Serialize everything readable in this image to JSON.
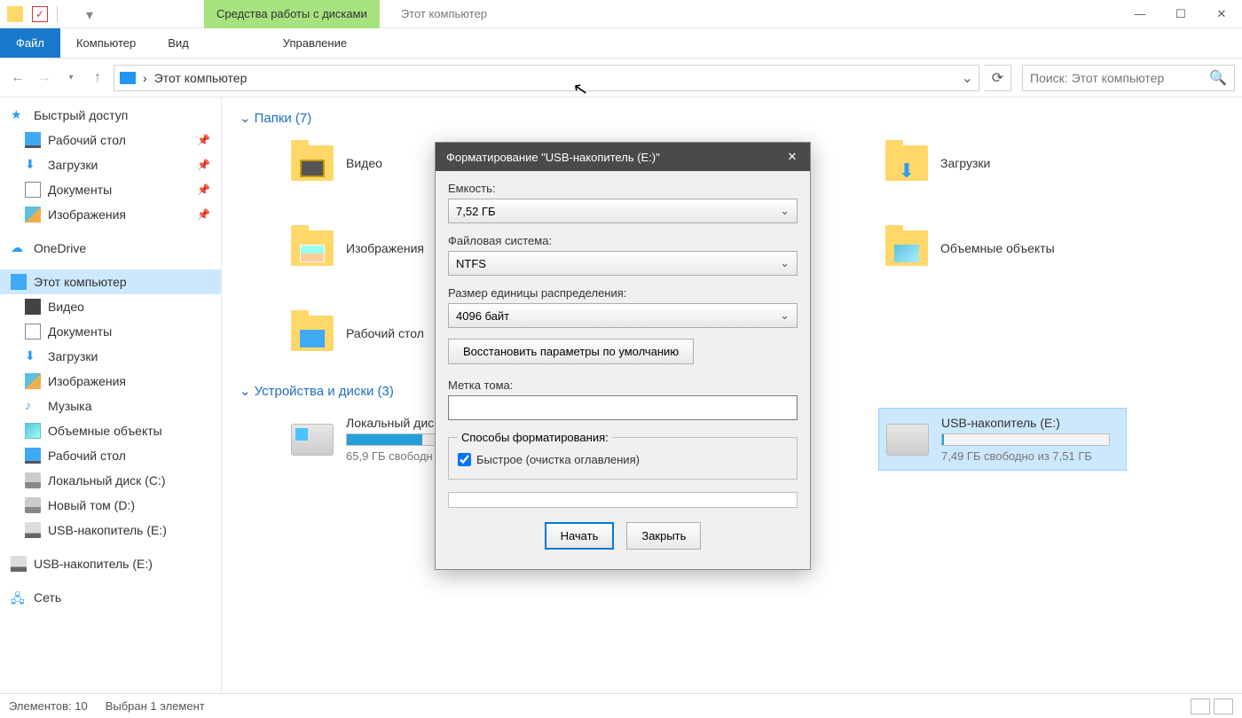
{
  "titlebar": {
    "context_tab": "Средства работы с дисками",
    "title": "Этот компьютер"
  },
  "ribbon": {
    "tabs": [
      "Файл",
      "Компьютер",
      "Вид",
      "Управление"
    ]
  },
  "navbar": {
    "crumb_sep": "›",
    "crumb": "Этот компьютер",
    "search_placeholder": "Поиск: Этот компьютер"
  },
  "sidebar": {
    "quick": "Быстрый доступ",
    "quick_items": [
      "Рабочий стол",
      "Загрузки",
      "Документы",
      "Изображения"
    ],
    "onedrive": "OneDrive",
    "this_pc": "Этот компьютер",
    "pc_items": [
      "Видео",
      "Документы",
      "Загрузки",
      "Изображения",
      "Музыка",
      "Объемные объекты",
      "Рабочий стол",
      "Локальный диск (C:)",
      "Новый том (D:)",
      "USB-накопитель (E:)"
    ],
    "usb2": "USB-накопитель (E:)",
    "network": "Сеть"
  },
  "content": {
    "folders_header": "Папки (7)",
    "drives_header": "Устройства и диски (3)",
    "folders": [
      "Видео",
      "Загрузки",
      "Изображения",
      "Объемные объекты",
      "Рабочий стол"
    ],
    "drive_c": {
      "label": "Локальный дис",
      "sub": "65,9 ГБ свободн"
    },
    "drive_usb": {
      "label": "USB-накопитель (E:)",
      "sub": "7,49 ГБ свободно из 7,51 ГБ"
    }
  },
  "dialog": {
    "title": "Форматирование \"USB-накопитель (E:)\"",
    "capacity_label": "Емкость:",
    "capacity_value": "7,52 ГБ",
    "fs_label": "Файловая система:",
    "fs_value": "NTFS",
    "alloc_label": "Размер единицы распределения:",
    "alloc_value": "4096 байт",
    "restore_btn": "Восстановить параметры по умолчанию",
    "volume_label": "Метка тома:",
    "volume_value": "",
    "methods_legend": "Способы форматирования:",
    "quick_cb": "Быстрое (очистка оглавления)",
    "start_btn": "Начать",
    "close_btn": "Закрыть"
  },
  "statusbar": {
    "count": "Элементов: 10",
    "selected": "Выбран 1 элемент"
  }
}
